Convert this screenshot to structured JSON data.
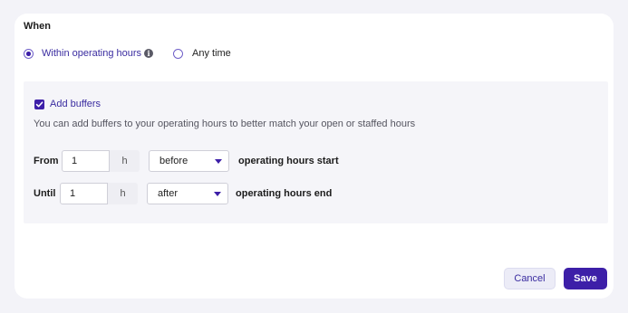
{
  "when": {
    "title": "When",
    "options": [
      {
        "label": "Within operating hours",
        "selected": true
      },
      {
        "label": "Any time",
        "selected": false
      }
    ],
    "info_icon": "info-icon"
  },
  "buffers": {
    "checkbox_label": "Add buffers",
    "checked": true,
    "helper": "You can add buffers to your operating hours to better match your open or staffed hours",
    "from": {
      "label": "From",
      "value": "1",
      "unit": "h",
      "relation": "before",
      "suffix": "operating hours start"
    },
    "until": {
      "label": "Until",
      "value": "1",
      "unit": "h",
      "relation": "after",
      "suffix": "operating hours end"
    }
  },
  "actions": {
    "cancel_label": "Cancel",
    "save_label": "Save"
  },
  "colors": {
    "accent": "#3d1fa8",
    "background": "#f3f3f8",
    "panel": "#f5f5f9"
  }
}
